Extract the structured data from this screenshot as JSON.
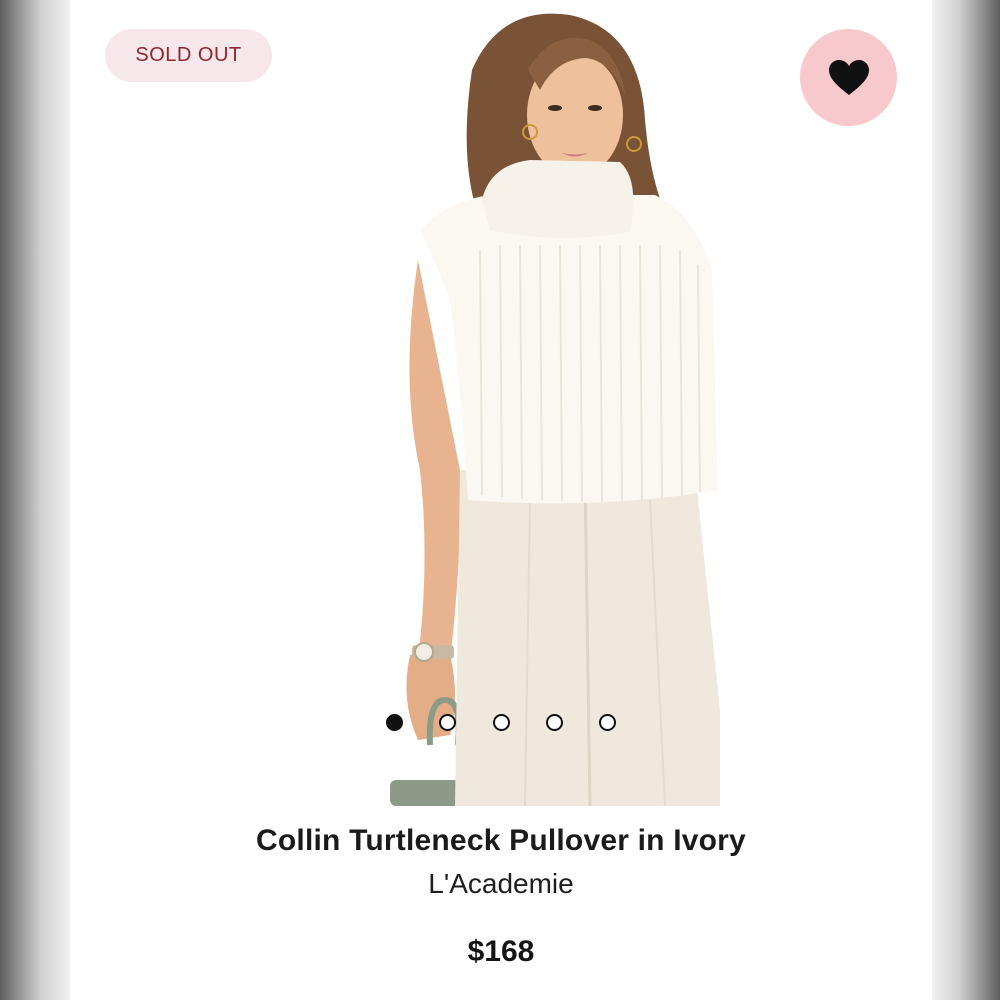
{
  "badge": {
    "label": "SOLD OUT"
  },
  "favorite": {
    "icon": "heart-icon",
    "state": "favorited"
  },
  "carousel": {
    "total": 5,
    "active_index": 1
  },
  "product": {
    "title": "Collin Turtleneck Pullover in Ivory",
    "brand": "L'Academie",
    "price": "$168"
  },
  "colors": {
    "badge_bg": "#f6e8ea",
    "badge_text": "#8e2530",
    "favorite_bg": "#f8c9cc",
    "heart": "#111111"
  }
}
